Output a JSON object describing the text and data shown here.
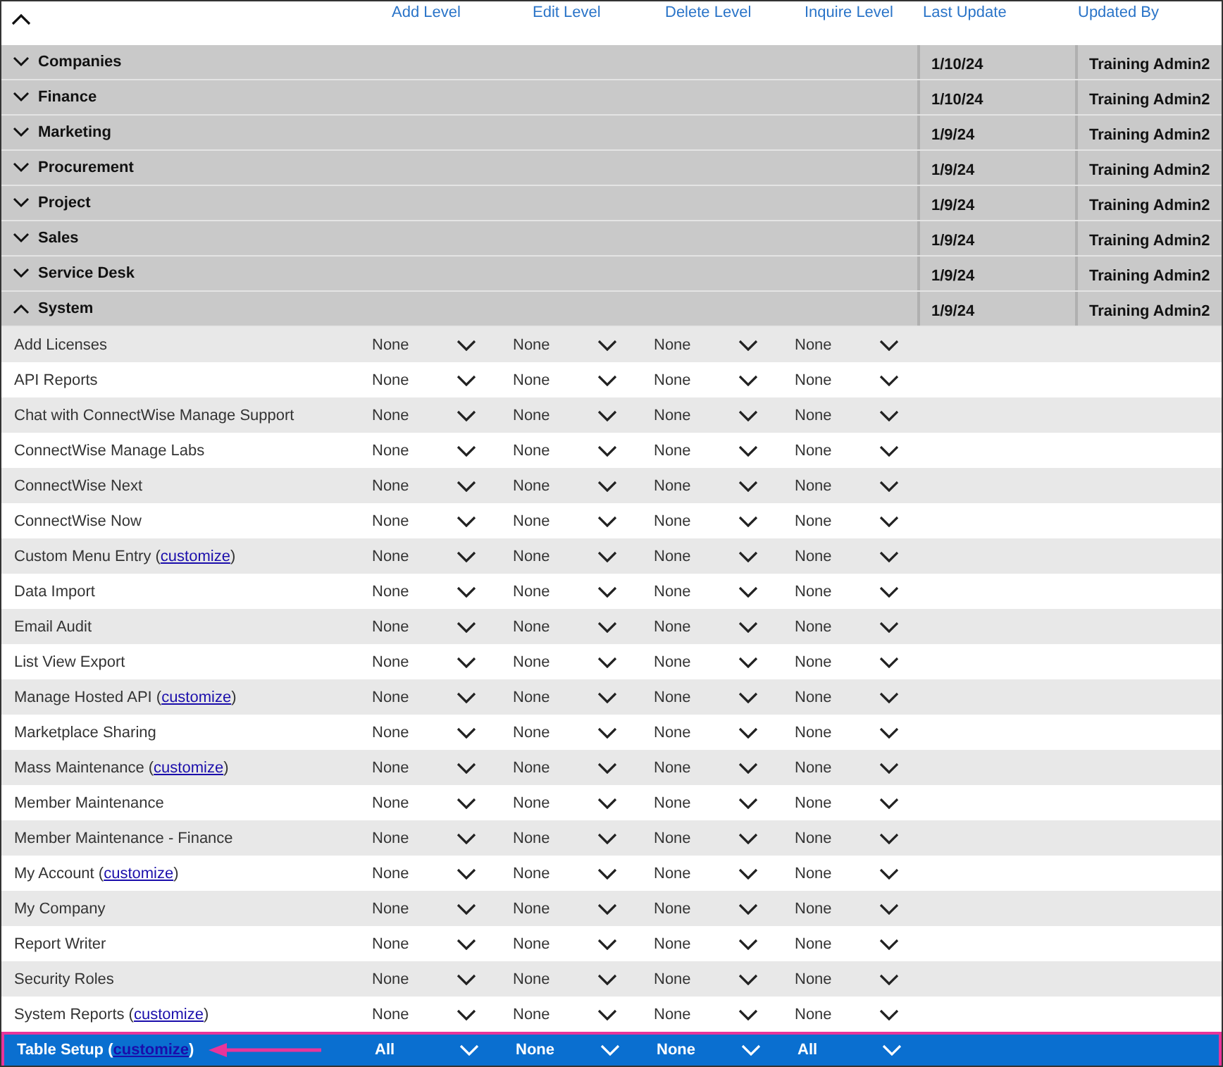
{
  "columns": [
    "Add Level",
    "Edit Level",
    "Delete Level",
    "Inquire Level",
    "Last Update",
    "Updated By"
  ],
  "groups": [
    {
      "label": "Companies",
      "expanded": false,
      "last_update": "1/10/24",
      "updated_by": "Training Admin2"
    },
    {
      "label": "Finance",
      "expanded": false,
      "last_update": "1/10/24",
      "updated_by": "Training Admin2"
    },
    {
      "label": "Marketing",
      "expanded": false,
      "last_update": "1/9/24",
      "updated_by": "Training Admin2"
    },
    {
      "label": "Procurement",
      "expanded": false,
      "last_update": "1/9/24",
      "updated_by": "Training Admin2"
    },
    {
      "label": "Project",
      "expanded": false,
      "last_update": "1/9/24",
      "updated_by": "Training Admin2"
    },
    {
      "label": "Sales",
      "expanded": false,
      "last_update": "1/9/24",
      "updated_by": "Training Admin2"
    },
    {
      "label": "Service Desk",
      "expanded": false,
      "last_update": "1/9/24",
      "updated_by": "Training Admin2"
    },
    {
      "label": "System",
      "expanded": true,
      "last_update": "1/9/24",
      "updated_by": "Training Admin2",
      "children": [
        {
          "label": "Add Licenses",
          "levels": [
            "None",
            "None",
            "None",
            "None"
          ],
          "selected": false
        },
        {
          "label": "API Reports",
          "levels": [
            "None",
            "None",
            "None",
            "None"
          ],
          "selected": false
        },
        {
          "label": "Chat with ConnectWise Manage Support",
          "levels": [
            "None",
            "None",
            "None",
            "None"
          ],
          "selected": false
        },
        {
          "label": "ConnectWise Manage Labs",
          "levels": [
            "None",
            "None",
            "None",
            "None"
          ],
          "selected": false
        },
        {
          "label": "ConnectWise Next",
          "levels": [
            "None",
            "None",
            "None",
            "None"
          ],
          "selected": false
        },
        {
          "label": "ConnectWise Now",
          "levels": [
            "None",
            "None",
            "None",
            "None"
          ],
          "selected": false
        },
        {
          "label": "Custom Menu Entry (",
          "link": "customize",
          "label_end": ")",
          "levels": [
            "None",
            "None",
            "None",
            "None"
          ],
          "selected": false
        },
        {
          "label": "Data Import",
          "levels": [
            "None",
            "None",
            "None",
            "None"
          ],
          "selected": false
        },
        {
          "label": "Email Audit",
          "levels": [
            "None",
            "None",
            "None",
            "None"
          ],
          "selected": false
        },
        {
          "label": "List View Export",
          "levels": [
            "None",
            "None",
            "None",
            "None"
          ],
          "selected": false
        },
        {
          "label": "Manage Hosted API (",
          "link": "customize",
          "label_end": ")",
          "levels": [
            "None",
            "None",
            "None",
            "None"
          ],
          "selected": false
        },
        {
          "label": "Marketplace Sharing",
          "levels": [
            "None",
            "None",
            "None",
            "None"
          ],
          "selected": false
        },
        {
          "label": "Mass Maintenance (",
          "link": "customize",
          "label_end": ")",
          "levels": [
            "None",
            "None",
            "None",
            "None"
          ],
          "selected": false
        },
        {
          "label": "Member Maintenance",
          "levels": [
            "None",
            "None",
            "None",
            "None"
          ],
          "selected": false
        },
        {
          "label": "Member Maintenance - Finance",
          "levels": [
            "None",
            "None",
            "None",
            "None"
          ],
          "selected": false
        },
        {
          "label": "My Account (",
          "link": "customize",
          "label_end": ")",
          "levels": [
            "None",
            "None",
            "None",
            "None"
          ],
          "selected": false
        },
        {
          "label": "My Company",
          "levels": [
            "None",
            "None",
            "None",
            "None"
          ],
          "selected": false
        },
        {
          "label": "Report Writer",
          "levels": [
            "None",
            "None",
            "None",
            "None"
          ],
          "selected": false
        },
        {
          "label": "Security Roles",
          "levels": [
            "None",
            "None",
            "None",
            "None"
          ],
          "selected": false
        },
        {
          "label": "System Reports (",
          "link": "customize",
          "label_end": ")",
          "levels": [
            "None",
            "None",
            "None",
            "None"
          ],
          "selected": false
        },
        {
          "label": "Table Setup (",
          "link": "customize",
          "label_end": ")",
          "levels": [
            "All",
            "None",
            "None",
            "All"
          ],
          "selected": true
        }
      ]
    }
  ]
}
